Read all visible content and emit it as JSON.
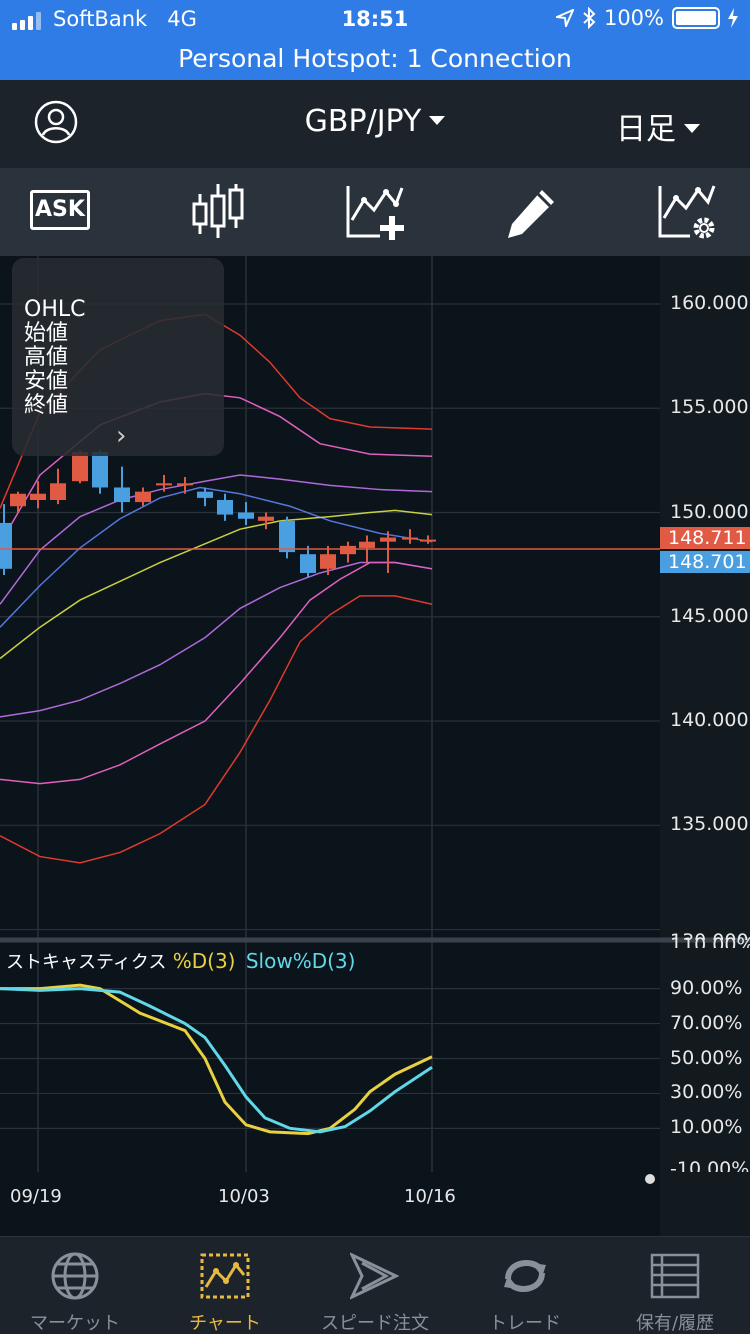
{
  "status": {
    "carrier": "SoftBank",
    "network": "4G",
    "time": "18:51",
    "battery": "100%",
    "hotspot": "Personal Hotspot: 1 Connection"
  },
  "header": {
    "pair": "GBP/JPY",
    "period": "日足",
    "icons": [
      "user-icon"
    ]
  },
  "toolbar": {
    "ask_label": "ASK",
    "icons": [
      "ask-icon",
      "candlestick-icon",
      "add-indicator-icon",
      "pencil-icon",
      "indicator-settings-icon"
    ]
  },
  "ohlc_panel": {
    "title": "OHLC",
    "open": "始値",
    "high": "高値",
    "low": "安値",
    "close": "終値"
  },
  "chart_data": {
    "type": "candlestick",
    "yticks": [
      "160.000",
      "155.000",
      "150.000",
      "145.000",
      "140.000",
      "135.000",
      "130.000"
    ],
    "ylim": [
      129.5,
      162.3
    ],
    "xticks": [
      "09/19",
      "10/03",
      "10/16"
    ],
    "price_bid": "148.711",
    "price_ask": "148.701",
    "indicator": {
      "name": "ストキャスティクス",
      "series_d": "%D(3)",
      "series_slow": "Slow%D(3)",
      "yticks": [
        "110.00%",
        "90.00%",
        "70.00%",
        "50.00%",
        "30.00%",
        "10.00%",
        "-10.00%"
      ]
    },
    "colors": {
      "up": "#e05a44",
      "down": "#4a9fe0",
      "band_outer": "#e03a2f",
      "band_mid": "#e060c0",
      "band_inner": "#b06ad8",
      "ma": "#5577dd",
      "ma_long": "#c8d040",
      "stoch_d": "#e8d040",
      "stoch_slow": "#60d8e8"
    }
  },
  "tabs": [
    {
      "label": "マーケット",
      "icon": "globe-icon"
    },
    {
      "label": "チャート",
      "icon": "chart-icon"
    },
    {
      "label": "スピード注文",
      "icon": "speed-order-icon"
    },
    {
      "label": "トレード",
      "icon": "trade-icon"
    },
    {
      "label": "保有/履歴",
      "icon": "history-icon"
    }
  ]
}
